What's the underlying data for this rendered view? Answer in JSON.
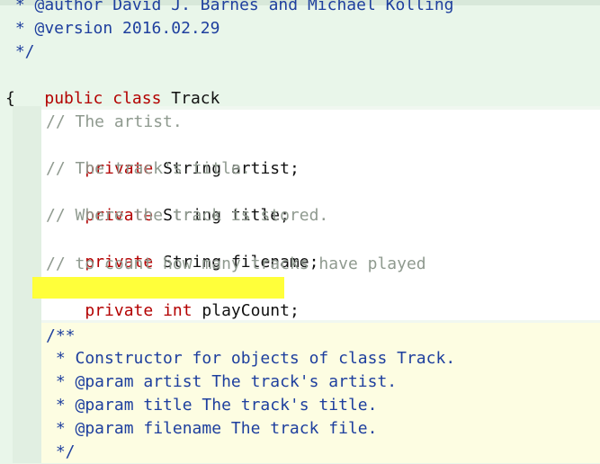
{
  "editor": {
    "header_comment": [
      " * @author David J. Barnes and Michael Kölling",
      " * @version 2016.02.29",
      " */"
    ],
    "class_decl": {
      "kw1": "public",
      "kw2": "class",
      "name": "Track"
    },
    "open_brace": "{",
    "fields": [
      {
        "comment": "// The artist.",
        "kw": "private",
        "type": "String",
        "name": "artist;"
      },
      {
        "comment": "// The track's title.",
        "kw": "private",
        "type": "String",
        "name": "title;"
      },
      {
        "comment": "// Where the track is stored.",
        "kw": "private",
        "type": "String",
        "name": "filename;"
      },
      {
        "comment": "// to count how many tracks have played",
        "kw": "private",
        "type": "int",
        "name": "playCount;"
      }
    ],
    "javadoc": [
      "/**",
      " * Constructor for objects of class Track.",
      " * @param artist The track's artist.",
      " * @param title The track's title.",
      " * @param filename The track file.",
      " */"
    ],
    "colors": {
      "keyword": "#b30000",
      "comment": "#8f9a8f",
      "javadoc": "#1e3f9e",
      "highlight": "#ffff3a"
    }
  }
}
